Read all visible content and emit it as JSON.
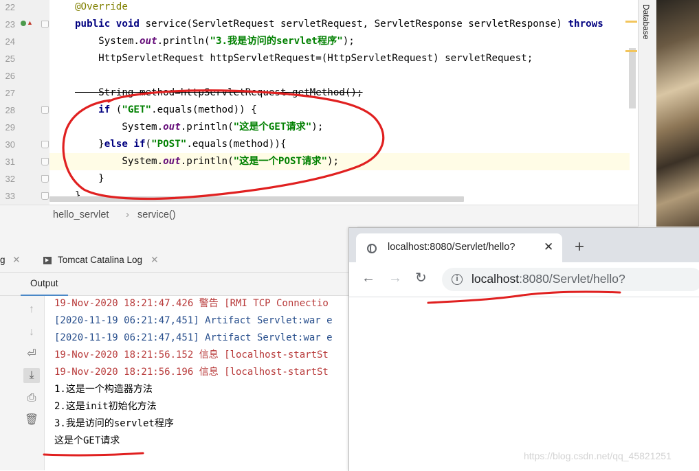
{
  "editor": {
    "lines": [
      {
        "n": "22",
        "tokens": [
          {
            "t": "@Override",
            "c": "ann"
          }
        ]
      },
      {
        "n": "23",
        "tokens": [
          {
            "t": "public void ",
            "c": "kw"
          },
          {
            "t": "service(ServletRequest servletRequest, ServletResponse servletResponse) ",
            "c": ""
          },
          {
            "t": "throws",
            "c": "kw"
          }
        ]
      },
      {
        "n": "24",
        "tokens": [
          {
            "t": "    System.",
            "c": ""
          },
          {
            "t": "out",
            "c": "fld"
          },
          {
            "t": ".println(",
            "c": ""
          },
          {
            "t": "\"3.我是访问的servlet程序\"",
            "c": "str"
          },
          {
            "t": ");",
            "c": ""
          }
        ]
      },
      {
        "n": "25",
        "tokens": [
          {
            "t": "    HttpServletRequest httpServletRequest=(HttpServletRequest) servletRequest;",
            "c": ""
          }
        ]
      },
      {
        "n": "26",
        "tokens": []
      },
      {
        "n": "27",
        "tokens": [
          {
            "t": "    String method=httpServletRequest.getMethod();",
            "c": "strike"
          }
        ]
      },
      {
        "n": "28",
        "tokens": [
          {
            "t": "    ",
            "c": ""
          },
          {
            "t": "if ",
            "c": "kw"
          },
          {
            "t": "(",
            "c": ""
          },
          {
            "t": "\"GET\"",
            "c": "str"
          },
          {
            "t": ".equals(method)) {",
            "c": ""
          }
        ]
      },
      {
        "n": "29",
        "tokens": [
          {
            "t": "        System.",
            "c": ""
          },
          {
            "t": "out",
            "c": "fld"
          },
          {
            "t": ".println(",
            "c": ""
          },
          {
            "t": "\"这是个GET请求\"",
            "c": "str"
          },
          {
            "t": ");",
            "c": ""
          }
        ]
      },
      {
        "n": "30",
        "tokens": [
          {
            "t": "    }",
            "c": ""
          },
          {
            "t": "else if",
            "c": "kw"
          },
          {
            "t": "(",
            "c": ""
          },
          {
            "t": "\"POST\"",
            "c": "str"
          },
          {
            "t": ".equals(method)){",
            "c": ""
          }
        ]
      },
      {
        "n": "31",
        "tokens": [
          {
            "t": "        System.",
            "c": ""
          },
          {
            "t": "out",
            "c": "fld"
          },
          {
            "t": ".println(",
            "c": ""
          },
          {
            "t": "\"这是一个POST请求\"",
            "c": "str"
          },
          {
            "t": ");",
            "c": ""
          }
        ]
      },
      {
        "n": "32",
        "tokens": [
          {
            "t": "    }",
            "c": ""
          }
        ]
      },
      {
        "n": "33",
        "tokens": [
          {
            "t": "}",
            "c": ""
          }
        ]
      }
    ],
    "highlighted_line": "31"
  },
  "right_panel": {
    "database_label": "Database"
  },
  "breadcrumb": {
    "class_name": "hello_servlet",
    "method_name": "service()"
  },
  "tool_window": {
    "tabs": [
      {
        "label": "g"
      },
      {
        "label": "Tomcat Catalina Log"
      }
    ],
    "output_tab": "Output",
    "console_lines": [
      {
        "text": "19-Nov-2020 18:21:47.426 警告 [RMI TCP Connectio",
        "style": "log-red"
      },
      {
        "text": "[2020-11-19 06:21:47,451] Artifact Servlet:war e",
        "style": "log-blue"
      },
      {
        "text": "[2020-11-19 06:21:47,451] Artifact Servlet:war e",
        "style": "log-blue"
      },
      {
        "text": "19-Nov-2020 18:21:56.152 信息 [localhost-startSt",
        "style": "log-red"
      },
      {
        "text": "19-Nov-2020 18:21:56.196 信息 [localhost-startSt",
        "style": "log-red"
      },
      {
        "text": "1.这是一个构造器方法",
        "style": "plain"
      },
      {
        "text": "2.这是init初始化方法",
        "style": "plain"
      },
      {
        "text": "3.我是访问的servlet程序",
        "style": "plain"
      },
      {
        "text": "这是个GET请求",
        "style": "plain"
      }
    ]
  },
  "browser": {
    "tab_title": "localhost:8080/Servlet/hello?",
    "tab_close": "✕",
    "new_tab": "+",
    "url_host": "localhost",
    "url_rest": ":8080/Servlet/hello?",
    "info_icon": "i"
  },
  "watermark": "https://blog.csdn.net/qq_45821251",
  "colors": {
    "annotation_red": "#e02020",
    "keyword": "#000080",
    "string": "#008000",
    "output_tab_underline": "#4a88c7"
  }
}
